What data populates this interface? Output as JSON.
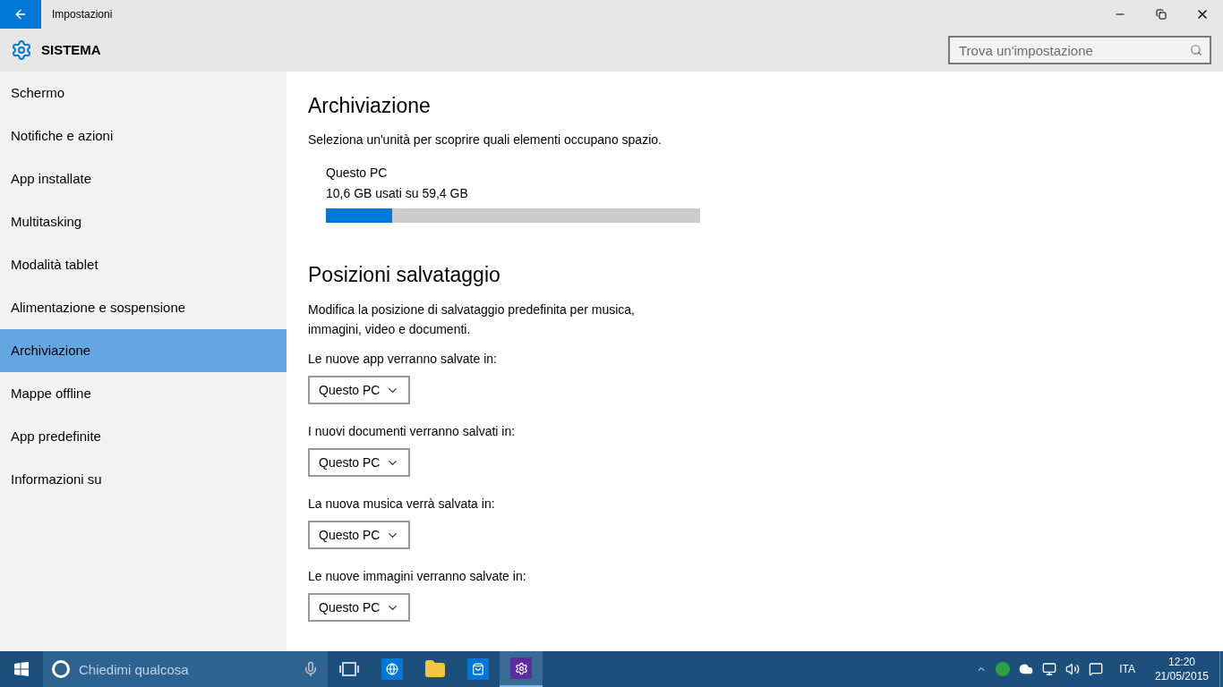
{
  "window": {
    "title": "Impostazioni"
  },
  "header": {
    "title": "SISTEMA"
  },
  "search": {
    "placeholder": "Trova un'impostazione"
  },
  "sidebar": {
    "items": [
      {
        "label": "Schermo",
        "selected": false
      },
      {
        "label": "Notifiche e azioni",
        "selected": false
      },
      {
        "label": "App installate",
        "selected": false
      },
      {
        "label": "Multitasking",
        "selected": false
      },
      {
        "label": "Modalità tablet",
        "selected": false
      },
      {
        "label": "Alimentazione e sospensione",
        "selected": false
      },
      {
        "label": "Archiviazione",
        "selected": true
      },
      {
        "label": "Mappe offline",
        "selected": false
      },
      {
        "label": "App predefinite",
        "selected": false
      },
      {
        "label": "Informazioni su",
        "selected": false
      }
    ]
  },
  "storage": {
    "title": "Archiviazione",
    "description": "Seleziona un'unità per scoprire quali elementi occupano spazio.",
    "drives": [
      {
        "name": "Questo PC",
        "usage": "10,6 GB usati su 59,4 GB",
        "level": 0.178
      }
    ]
  },
  "save_locations": {
    "title": "Posizioni salvataggio",
    "description": "Modifica la posizione di salvataggio predefinita per musica, immagini, video e documenti.",
    "items": [
      {
        "label": "Le nuove app verranno salvate in:",
        "value": "Questo PC"
      },
      {
        "label": "I nuovi documenti verranno salvati in:",
        "value": "Questo PC"
      },
      {
        "label": "La nuova musica verrà salvata in:",
        "value": "Questo PC"
      },
      {
        "label": "Le nuove immagini verranno salvate in:",
        "value": "Questo PC"
      }
    ]
  },
  "taskbar": {
    "search_placeholder": "Chiedimi qualcosa",
    "apps": [
      {
        "kind": "task-view",
        "selected": false
      },
      {
        "kind": "browser",
        "selected": false
      },
      {
        "kind": "explorer",
        "selected": false
      },
      {
        "kind": "store",
        "selected": false
      },
      {
        "kind": "settings",
        "selected": true
      }
    ],
    "language": "ITA",
    "time": "12:20",
    "date": "21/05/2015"
  }
}
